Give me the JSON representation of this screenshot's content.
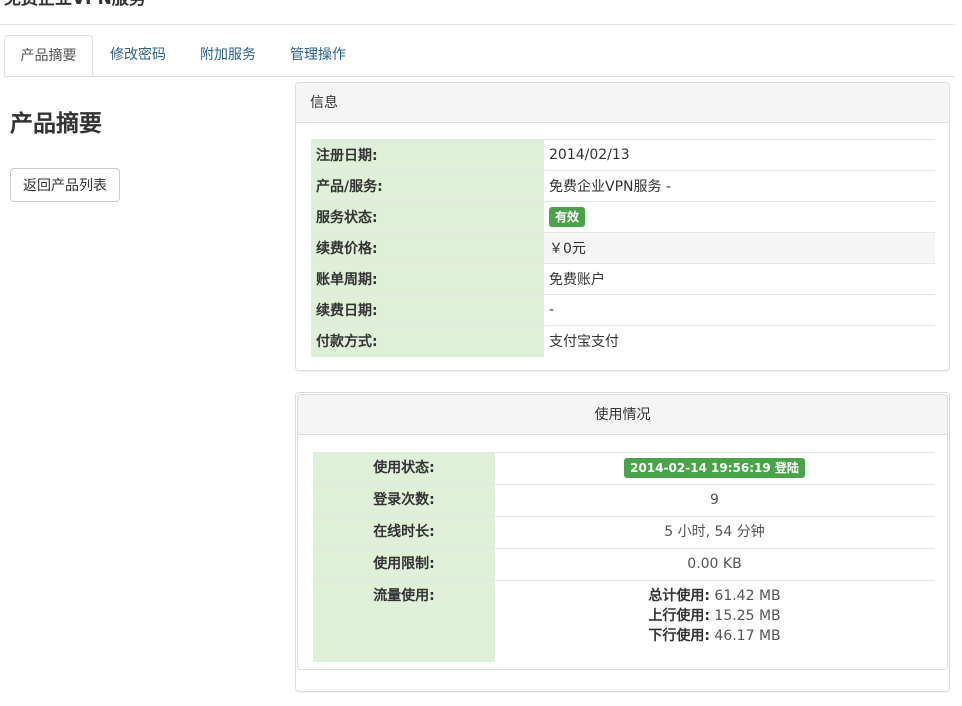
{
  "page": {
    "title": "免费企业VPN服务"
  },
  "tabs": [
    {
      "label": "产品摘要",
      "active": true
    },
    {
      "label": "修改密码",
      "active": false
    },
    {
      "label": "附加服务",
      "active": false
    },
    {
      "label": "管理操作",
      "active": false
    }
  ],
  "sidebar": {
    "heading": "产品摘要",
    "back_button": "返回产品列表"
  },
  "info": {
    "title": "信息",
    "rows": [
      {
        "label": "注册日期:",
        "value": "2014/02/13"
      },
      {
        "label": "产品/服务:",
        "value": "免费企业VPN服务 -"
      },
      {
        "label": "服务状态:",
        "value": "有效"
      },
      {
        "label": "续费价格:",
        "value": "￥0元"
      },
      {
        "label": "账单周期:",
        "value": "免费账户"
      },
      {
        "label": "续费日期:",
        "value": "-"
      },
      {
        "label": "付款方式:",
        "value": "支付宝支付"
      }
    ]
  },
  "usage": {
    "title": "使用情况",
    "rows": [
      {
        "label": "使用状态:",
        "value": "2014-02-14 19:56:19 登陆"
      },
      {
        "label": "登录次数:",
        "value": "9"
      },
      {
        "label": "在线时长:",
        "value": "5 小时, 54 分钟"
      },
      {
        "label": "使用限制:",
        "value": "0.00 KB"
      },
      {
        "label": "流量使用:"
      }
    ],
    "traffic": {
      "total_label": "总计使用:",
      "total_value": "61.42 MB",
      "up_label": "上行使用:",
      "up_value": "15.25 MB",
      "down_label": "下行使用:",
      "down_value": "46.17 MB"
    }
  },
  "colors": {
    "label_bg": "#dff0d8",
    "badge_green": "#47a447",
    "link": "#2a6496"
  }
}
